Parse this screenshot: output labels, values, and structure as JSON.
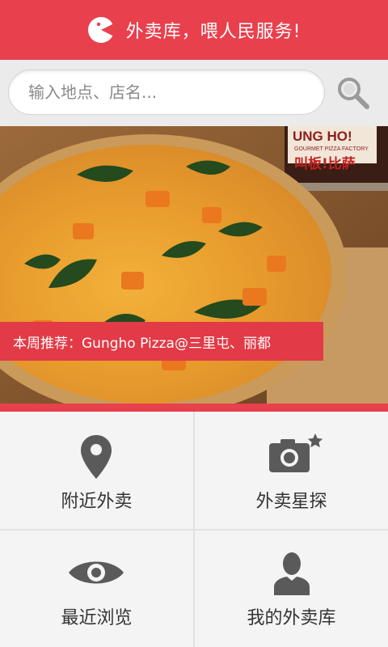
{
  "header": {
    "title": "外卖库，喂人民服务!"
  },
  "search": {
    "placeholder": "输入地点、店名..."
  },
  "banner": {
    "label": "本周推荐：Gungho Pizza@三里屯、丽都",
    "can_text_1": "UNG HO!",
    "can_text_2": "GOURMET PIZZA FACTORY",
    "can_text_3": "叫板!比萨"
  },
  "menu": {
    "nearby": "附近外卖",
    "explorer": "外卖星探",
    "recent": "最近浏览",
    "mine": "我的外卖库"
  },
  "colors": {
    "accent": "#e8404d",
    "icon": "#5a5a5a"
  }
}
